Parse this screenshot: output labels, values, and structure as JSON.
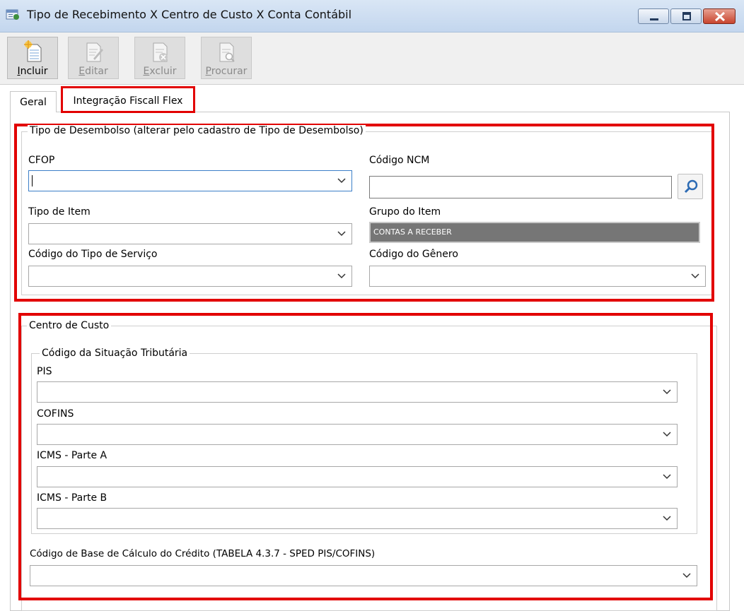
{
  "window": {
    "title": "Tipo de Recebimento X Centro de Custo X Conta Contábil"
  },
  "toolbar": {
    "incluir": "Incluir",
    "editar": "Editar",
    "excluir": "Excluir",
    "procurar": "Procurar"
  },
  "tabs": {
    "geral": "Geral",
    "integracao": "Integração Fiscall Flex",
    "active": "Integração Fiscall Flex"
  },
  "desembolso": {
    "title": "Tipo de Desembolso (alterar pelo cadastro de Tipo de Desembolso)",
    "cfop_label": "CFOP",
    "cfop_value": "",
    "ncm_label": "Código NCM",
    "ncm_value": "",
    "tipo_item_label": "Tipo de Item",
    "tipo_item_value": "",
    "grupo_item_label": "Grupo do Item",
    "grupo_item_value": "CONTAS A RECEBER",
    "tipo_servico_label": "Código do Tipo de Serviço",
    "tipo_servico_value": "",
    "genero_label": "Código do Gênero",
    "genero_value": ""
  },
  "centro_custo": {
    "title": "Centro de Custo",
    "cst_title": "Código da Situação Tributária",
    "pis_label": "PIS",
    "cofins_label": "COFINS",
    "icms_a_label": "ICMS -  Parte A",
    "icms_b_label": "ICMS -  Parte B",
    "base_calculo_label": "Código de Base de Cálculo do Crédito (TABELA 4.3.7 - SPED PIS/COFINS)"
  },
  "colors": {
    "highlight": "#e20000",
    "focus": "#3c7fc8",
    "readonly_bg": "#767676"
  },
  "icons": [
    "app-icon",
    "minimize-icon",
    "maximize-icon",
    "close-icon",
    "new-document-icon",
    "edit-document-icon",
    "delete-document-icon",
    "search-document-icon",
    "magnifier-icon",
    "chevron-down-icon"
  ]
}
